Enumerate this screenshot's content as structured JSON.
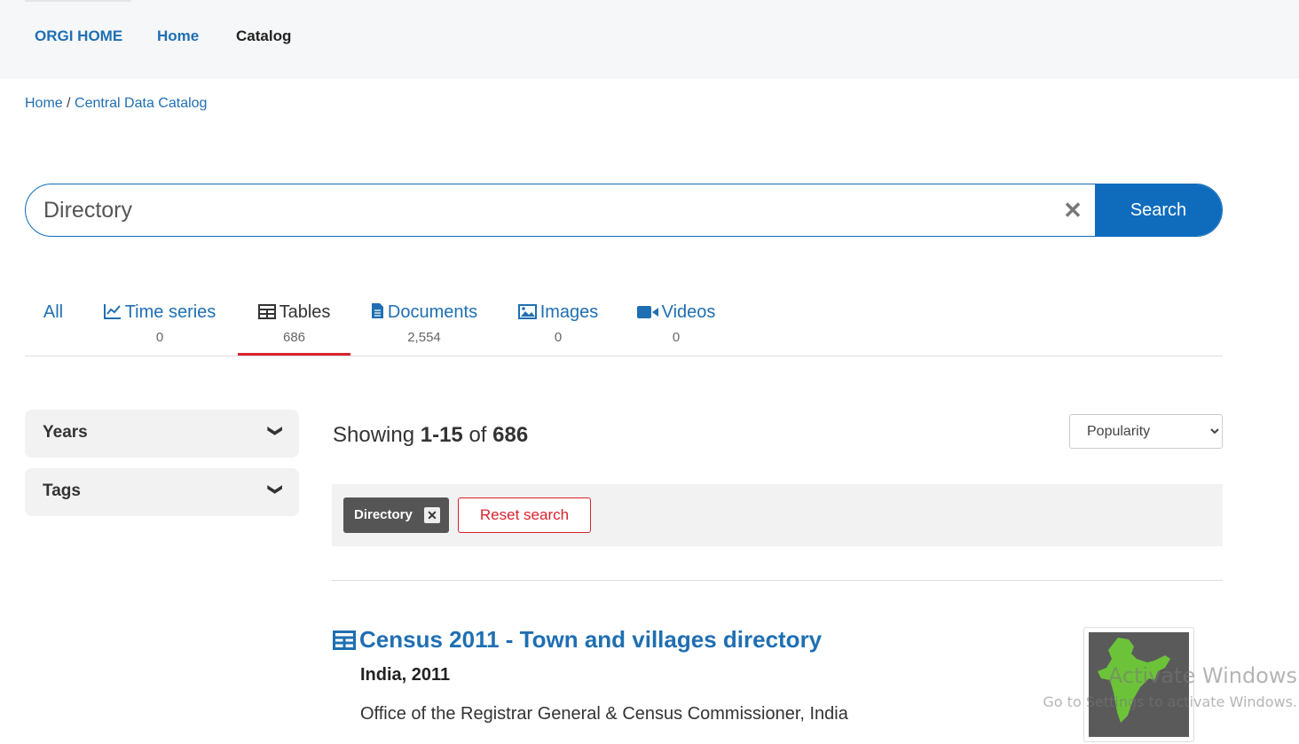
{
  "nav": {
    "brand": "ORGI HOME",
    "home": "Home",
    "catalog": "Catalog"
  },
  "breadcrumb": {
    "home": "Home",
    "sep": " / ",
    "current": "Central Data Catalog"
  },
  "search": {
    "value": "Directory",
    "button": "Search"
  },
  "tabs": [
    {
      "label": "All",
      "count": ""
    },
    {
      "label": "Time series",
      "count": "0",
      "icon": "chart-line-icon"
    },
    {
      "label": "Tables",
      "count": "686",
      "icon": "table-icon"
    },
    {
      "label": "Documents",
      "count": "2,554",
      "icon": "file-icon"
    },
    {
      "label": "Images",
      "count": "0",
      "icon": "image-icon"
    },
    {
      "label": "Videos",
      "count": "0",
      "icon": "video-icon"
    }
  ],
  "facets": {
    "years": "Years",
    "tags": "Tags"
  },
  "results": {
    "showing_prefix": "Showing ",
    "range": "1-15",
    "of": " of ",
    "total": "686",
    "sort": "Popularity"
  },
  "filters": {
    "chip": "Directory",
    "reset": "Reset search"
  },
  "result_item": {
    "title": "Census 2011 - Town and villages directory",
    "subtitle": "India, 2011",
    "org": "Office of the Registrar General & Census Commissioner, India"
  },
  "watermark": {
    "line1": "Activate Windows",
    "line2": "Go to Settings to activate Windows."
  },
  "colors": {
    "accent": "#0f6cbd",
    "active_tab": "#d9232d",
    "link": "#1f6fb2"
  }
}
